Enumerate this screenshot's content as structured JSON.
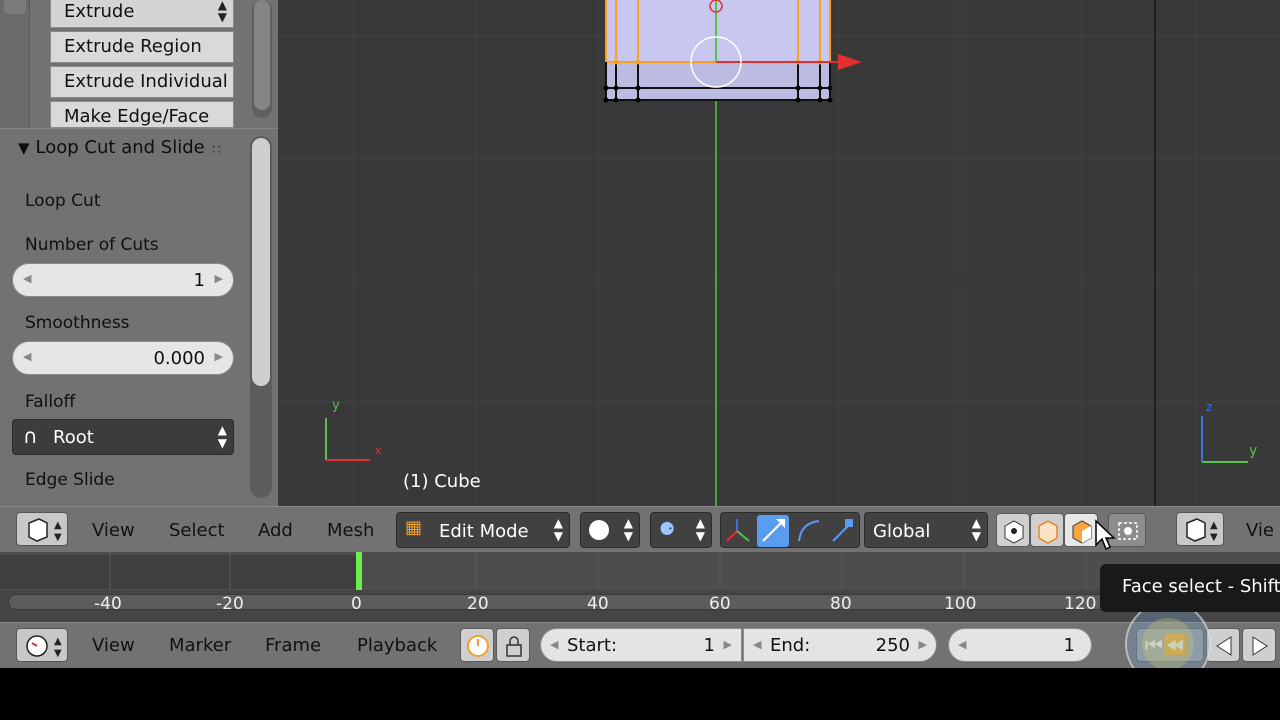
{
  "tool_shelf": {
    "buttons": [
      {
        "label": "Extrude",
        "has_dropdown": true
      },
      {
        "label": "Extrude Region"
      },
      {
        "label": "Extrude Individual"
      },
      {
        "label": "Make Edge/Face"
      }
    ]
  },
  "operator_panel": {
    "title": "Loop Cut and Slide",
    "section_label": "Loop Cut",
    "number_of_cuts_label": "Number of Cuts",
    "number_of_cuts_value": "1",
    "smoothness_label": "Smoothness",
    "smoothness_value": "0.000",
    "falloff_label": "Falloff",
    "falloff_value": "Root",
    "edge_slide_label": "Edge Slide"
  },
  "viewport": {
    "object_label": "(1) Cube",
    "axis_left": {
      "y": "y",
      "x": "x"
    },
    "axis_right": {
      "z": "z",
      "y": "y"
    },
    "colors": {
      "background": "#393939",
      "grid_line": "#434343",
      "x_axis": "#e23030",
      "y_axis": "#56c24a",
      "z_axis": "#3a6fe0",
      "face_fill": "#c7c7f0",
      "edge_selected": "#ff9e1f"
    }
  },
  "header_3d": {
    "menus": [
      "View",
      "Select",
      "Add",
      "Mesh"
    ],
    "mode": "Edit Mode",
    "orientation": "Global",
    "right_view_label": "Vie",
    "icons": [
      "editor-type-icon",
      "mode-icon",
      "viewport-shading-icon",
      "pivot-point-icon",
      "manipulator-toggle-icon",
      "translate-manipulator-icon",
      "rotate-manipulator-icon",
      "scale-manipulator-icon",
      "vertex-select-icon",
      "edge-select-icon",
      "face-select-icon",
      "limit-selection-visible-icon"
    ]
  },
  "timeline": {
    "ticks": [
      "-40",
      "-20",
      "0",
      "20",
      "40",
      "60",
      "80",
      "100",
      "120"
    ],
    "current_frame_marker": 0
  },
  "header_timeline": {
    "menus": [
      "View",
      "Marker",
      "Frame",
      "Playback"
    ],
    "start_label": "Start:",
    "start_value": "1",
    "end_label": "End:",
    "end_value": "250",
    "current_frame": "1"
  },
  "tooltip": {
    "text": "Face select - Shift-"
  }
}
